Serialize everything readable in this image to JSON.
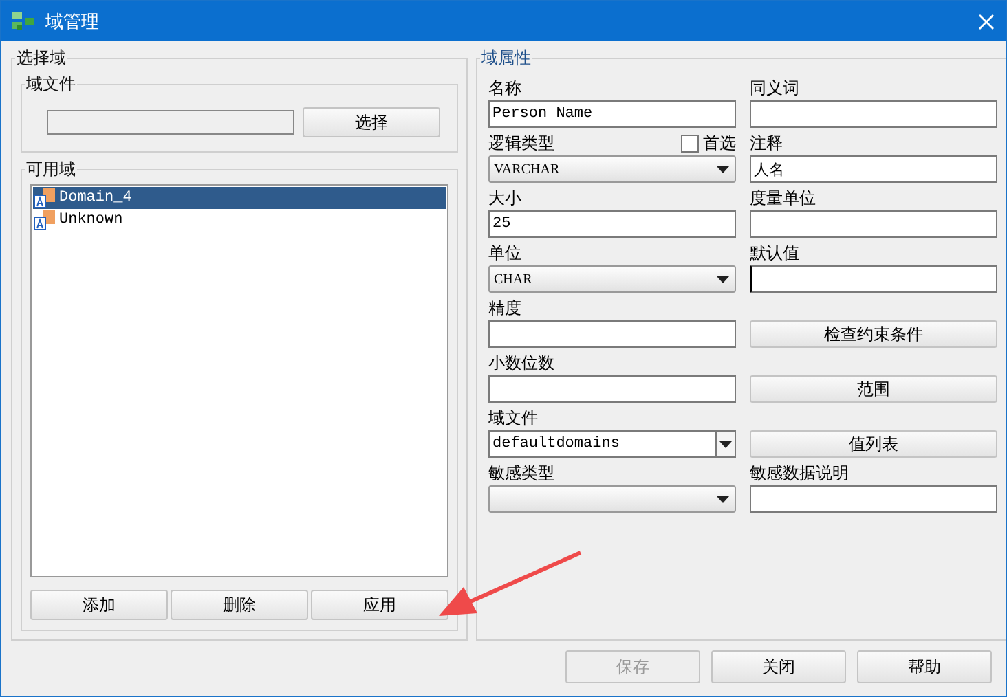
{
  "window": {
    "title": "域管理"
  },
  "select_domain": {
    "title": "选择域",
    "file_group": {
      "title": "域文件",
      "button": "选择"
    },
    "available": {
      "title": "可用域",
      "items": [
        {
          "label": "Domain_4",
          "selected": true
        },
        {
          "label": "Unknown",
          "selected": false
        }
      ],
      "buttons": [
        "添加",
        "删除",
        "应用"
      ]
    }
  },
  "properties": {
    "title": "域属性",
    "rows": [
      {
        "left": {
          "kind": "text",
          "label": "名称",
          "value": "Person Name"
        },
        "right": {
          "kind": "text",
          "label": "同义词"
        }
      },
      {
        "left": {
          "kind": "select",
          "label": "逻辑类型",
          "value": "VARCHAR",
          "checkbox": {
            "label": "首选",
            "checked": false
          }
        },
        "right": {
          "kind": "text",
          "label": "注释",
          "value": "人名"
        }
      },
      {
        "left": {
          "kind": "text",
          "label": "大小",
          "value": "25"
        },
        "right": {
          "kind": "text",
          "label": "度量单位"
        }
      },
      {
        "left": {
          "kind": "select",
          "label": "单位",
          "value": "CHAR"
        },
        "right": {
          "kind": "text",
          "label": "默认值",
          "focused": true
        }
      },
      {
        "left": {
          "kind": "text",
          "label": "精度"
        },
        "right": {
          "kind": "button",
          "label": "检查约束条件"
        }
      },
      {
        "left": {
          "kind": "text",
          "label": "小数位数"
        },
        "right": {
          "kind": "button",
          "label": "范围"
        }
      },
      {
        "left": {
          "kind": "combo",
          "label": "域文件",
          "value": "defaultdomains"
        },
        "right": {
          "kind": "button",
          "label": "值列表"
        }
      },
      {
        "left": {
          "kind": "select",
          "label": "敏感类型"
        },
        "right": {
          "kind": "text",
          "label": "敏感数据说明"
        }
      }
    ]
  },
  "footer_buttons": [
    {
      "label": "保存",
      "disabled": true
    },
    {
      "label": "关闭",
      "disabled": false
    },
    {
      "label": "帮助",
      "disabled": false
    }
  ],
  "annotation": {
    "kind": "arrow"
  }
}
